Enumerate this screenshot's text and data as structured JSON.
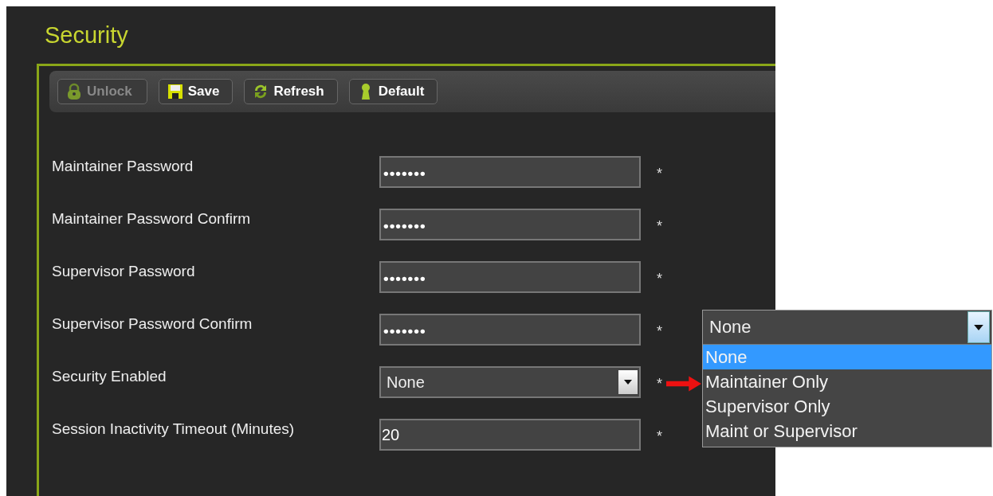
{
  "title": "Security",
  "toolbar": [
    {
      "label": "Unlock",
      "kind": "lock",
      "disabled": true
    },
    {
      "label": "Save",
      "kind": "save",
      "disabled": false
    },
    {
      "label": "Refresh",
      "kind": "refresh",
      "disabled": false
    },
    {
      "label": "Default",
      "kind": "default",
      "disabled": false
    }
  ],
  "fields": [
    {
      "label": "Maintainer Password",
      "kind": "password",
      "value": "•••••••",
      "required": "*"
    },
    {
      "label": "Maintainer Password Confirm",
      "kind": "password",
      "value": "•••••••",
      "required": "*"
    },
    {
      "label": "Supervisor Password",
      "kind": "password",
      "value": "•••••••",
      "required": "*"
    },
    {
      "label": "Supervisor Password Confirm",
      "kind": "password",
      "value": "•••••••",
      "required": "*"
    },
    {
      "label": "Security Enabled",
      "kind": "select",
      "value": "None",
      "required": "*"
    },
    {
      "label": "Session Inactivity Timeout (Minutes)",
      "kind": "text",
      "value": "20",
      "required": "*"
    }
  ],
  "callout": {
    "value": "None",
    "options": [
      {
        "label": "None",
        "selected": true
      },
      {
        "label": "Maintainer Only",
        "selected": false
      },
      {
        "label": "Supervisor Only",
        "selected": false
      },
      {
        "label": "Maint or Supervisor",
        "selected": false
      }
    ]
  }
}
